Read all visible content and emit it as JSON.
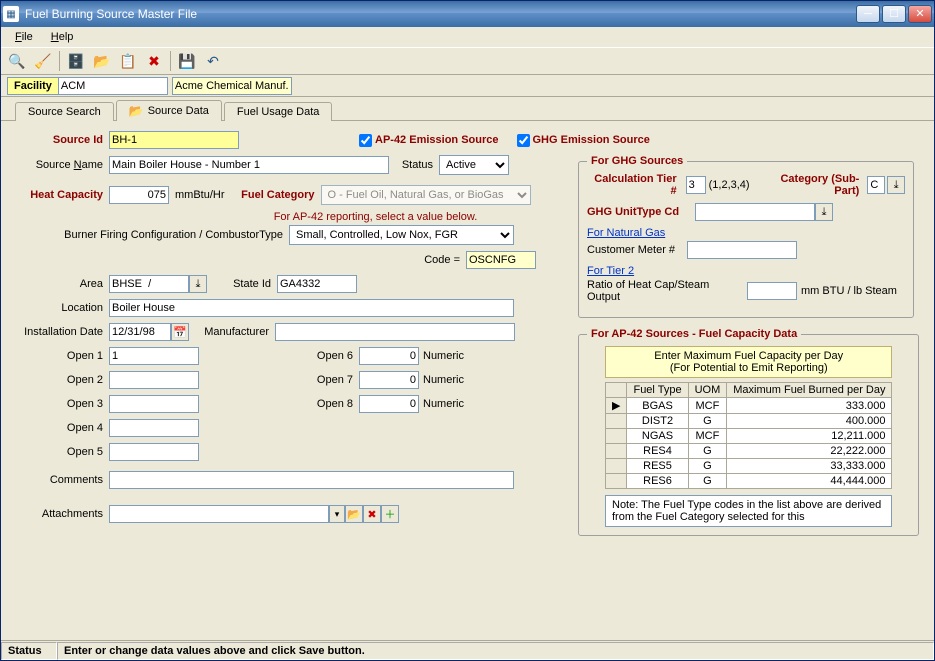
{
  "window": {
    "title": "Fuel Burning Source Master File"
  },
  "menu": {
    "file": "File",
    "help": "Help"
  },
  "facility": {
    "label": "Facility",
    "code": "ACM",
    "name": "Acme Chemical Manuf."
  },
  "tabs": {
    "search": "Source Search",
    "data": "Source Data",
    "fuel": "Fuel Usage Data"
  },
  "source": {
    "id_label": "Source Id",
    "id": "BH-1",
    "ap42_chk": "AP-42 Emission Source",
    "ghg_chk": "GHG Emission Source",
    "name_label": "Source Name",
    "name": "Main Boiler House - Number 1",
    "status_label": "Status",
    "status": "Active",
    "heatcap_label": "Heat Capacity",
    "heatcap": "075",
    "heatcap_uom": "mmBtu/Hr",
    "fuelcat_label": "Fuel Category",
    "fuelcat": "O  - Fuel Oil, Natural Gas, or BioGas",
    "ap42_hint": "For AP-42 reporting, select a value below.",
    "burner_label": "Burner Firing Configuration / CombustorType",
    "burner": "Small, Controlled, Low Nox, FGR",
    "code_label": "Code =",
    "code": "OSCNFG",
    "area_label": "Area",
    "area": "BHSE  /",
    "stateid_label": "State Id",
    "stateid": "GA4332",
    "location_label": "Location",
    "location": "Boiler House",
    "install_label": "Installation Date",
    "install": "12/31/98",
    "manuf_label": "Manufacturer",
    "manuf": "",
    "open_labels": [
      "Open 1",
      "Open 2",
      "Open 3",
      "Open 4",
      "Open 5",
      "Open 6",
      "Open 7",
      "Open 8"
    ],
    "open1": "1",
    "open2": "",
    "open3": "",
    "open4": "",
    "open5": "",
    "open6": "0",
    "open7": "0",
    "open8": "0",
    "numeric": "Numeric",
    "comments_label": "Comments",
    "comments": "",
    "attach_label": "Attachments"
  },
  "ghg": {
    "legend": "For GHG Sources",
    "tier_label": "Calculation Tier #",
    "tier": "3",
    "tier_hint": "(1,2,3,4)",
    "cat_label": "Category (Sub-Part)",
    "cat": "C",
    "unit_label": "GHG UnitType Cd",
    "unit": "",
    "ng_link": "For Natural Gas",
    "meter_label": "Customer Meter #",
    "meter": "",
    "t2_link": "For Tier 2",
    "ratio_label": "Ratio of Heat Cap/Steam Output",
    "ratio": "",
    "ratio_uom": "mm BTU / lb Steam"
  },
  "ap42": {
    "legend": "For AP-42 Sources - Fuel Capacity Data",
    "hint1": "Enter Maximum Fuel Capacity per Day",
    "hint2": "(For Potential to Emit Reporting)",
    "cols": [
      "Fuel Type",
      "UOM",
      "Maximum Fuel Burned per Day"
    ],
    "rows": [
      {
        "ft": "BGAS",
        "uom": "MCF",
        "max": "333.000"
      },
      {
        "ft": "DIST2",
        "uom": "G",
        "max": "400.000"
      },
      {
        "ft": "NGAS",
        "uom": "MCF",
        "max": "12,211.000"
      },
      {
        "ft": "RES4",
        "uom": "G",
        "max": "22,222.000"
      },
      {
        "ft": "RES5",
        "uom": "G",
        "max": "33,333.000"
      },
      {
        "ft": "RES6",
        "uom": "G",
        "max": "44,444.000"
      }
    ],
    "note": "Note:  The Fuel Type codes in the list above are derived from the Fuel Category selected for this"
  },
  "status": {
    "label": "Status",
    "msg": "Enter or change data values above and click Save button."
  }
}
